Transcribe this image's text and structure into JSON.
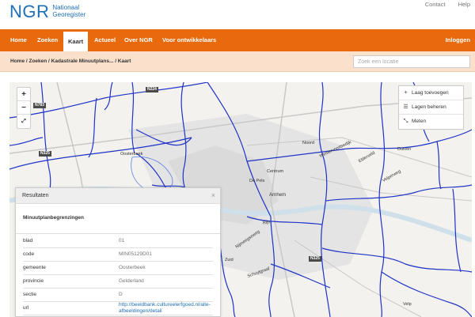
{
  "header": {
    "logo_main": "NGR",
    "logo_sub_1": "Nationaal",
    "logo_sub_2": "Georegister",
    "links": [
      "Contact",
      "Help"
    ]
  },
  "nav": {
    "items": [
      "Home",
      "Zoeken",
      "Kaart",
      "Actueel",
      "Over NGR",
      "Voor ontwikkelaars"
    ],
    "active": "Kaart",
    "login": "Inloggen",
    "accent_color": "#e86a0c"
  },
  "breadcrumb": {
    "text": "Home / Zoeken / Kadastrale Minuutplans... / Kaart"
  },
  "search": {
    "placeholder": "Zoek een locatie"
  },
  "map": {
    "zoom_in": "+",
    "zoom_out": "−",
    "fullscreen": "⤢",
    "layer_add": "Laag toevoegen",
    "layer_manage": "Lagen beheren",
    "measure": "Meten",
    "labels": {
      "noord": "Noord",
      "oosterbeek": "Oosterbeek",
      "centrum": "Centrum",
      "de_pels": "De Pels",
      "arnhem": "Arnhem",
      "zuid": "Zuid",
      "westervoortsedijk": "Westervoortsedijk",
      "nijmeegseweg": "Nijmeegseweg",
      "velperweg": "Velperweg",
      "elderveld": "Elderveld",
      "schuytgraaf": "Schuytgraaf",
      "duiven": "Duiven",
      "velp": "Velp",
      "rijn": "Rijn"
    },
    "roads": [
      "N783",
      "N224",
      "N325",
      "N325"
    ],
    "boundary_color": "#1f33c7"
  },
  "results": {
    "title": "Resultaten",
    "close": "×",
    "section": "Minuutplanbegrenzingen",
    "rows": [
      {
        "key": "blad",
        "value": "01"
      },
      {
        "key": "code",
        "value": "MIN05129D01"
      },
      {
        "key": "gemeente",
        "value": "Oosterbeek"
      },
      {
        "key": "provincie",
        "value": "Gelderland"
      },
      {
        "key": "sectie",
        "value": "D"
      },
      {
        "key": "url",
        "value": "http://beeldbank.cultureelerfgoed.nl/alle-afbeeldingen/detail"
      }
    ]
  }
}
